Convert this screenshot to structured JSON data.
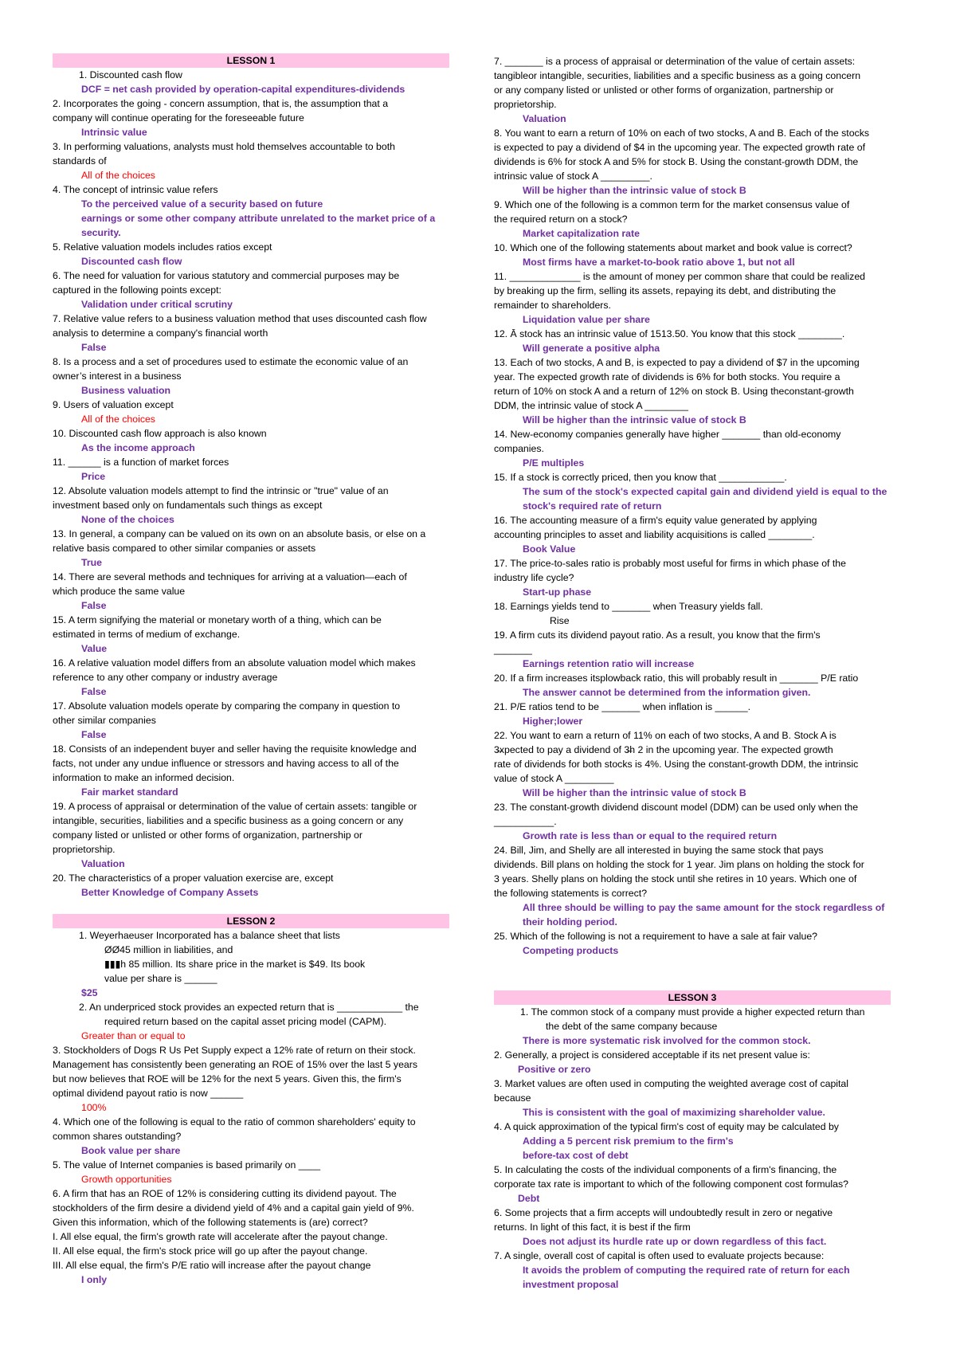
{
  "colors": {
    "answer": "#7030a0",
    "alt_answer": "#ff0000",
    "header_band": "#ffc3e6",
    "text": "#000000"
  },
  "left_column": [
    {
      "k": "h",
      "t": "LESSON 1"
    },
    {
      "k": "n1",
      "t": "1.  Discounted cash flow"
    },
    {
      "k": "a",
      "t": "DCF = net cash provided by operation-capital expenditures-dividends"
    },
    {
      "k": "q",
      "t": "2. Incorporates the going - concern assumption, that is, the assumption that a"
    },
    {
      "k": "q",
      "t": "company will continue operating for the foreseeable future"
    },
    {
      "k": "a",
      "t": "Intrinsic value"
    },
    {
      "k": "q",
      "t": "3. In performing valuations, analysts must hold themselves accountable to both"
    },
    {
      "k": "q",
      "t": "standards of"
    },
    {
      "k": "r",
      "t": "All of the choices"
    },
    {
      "k": "q",
      "t": "4. The concept of intrinsic value refers"
    },
    {
      "k": "a",
      "t": "To the perceived value of a security based on future"
    },
    {
      "k": "a",
      "t": "earnings or some other company attribute unrelated to the market price of a"
    },
    {
      "k": "a",
      "t": "security."
    },
    {
      "k": "q",
      "t": "5. Relative valuation models includes ratios except"
    },
    {
      "k": "a",
      "t": "Discounted cash flow"
    },
    {
      "k": "q",
      "t": "6. The need for valuation for various statutory and commercial purposes may be"
    },
    {
      "k": "q",
      "t": "captured in the following points except:"
    },
    {
      "k": "a",
      "t": "Validation under critical scrutiny"
    },
    {
      "k": "q",
      "t": "7. Relative value refers to a business valuation method that uses discounted cash flow"
    },
    {
      "k": "q",
      "t": "analysis to determine a company's financial worth"
    },
    {
      "k": "a",
      "t": "False"
    },
    {
      "k": "q",
      "t": "8. Is a process and a set of procedures used to estimate the economic value of an"
    },
    {
      "k": "q",
      "t": "owner’s interest in a business"
    },
    {
      "k": "a",
      "t": "Business valuation"
    },
    {
      "k": "q",
      "t": "9. Users of valuation except"
    },
    {
      "k": "r",
      "t": "All of the choices"
    },
    {
      "k": "q",
      "t": "10. Discounted cash flow approach is also known"
    },
    {
      "k": "a",
      "t": "As the income approach"
    },
    {
      "k": "q",
      "t": "11. ______ is a function of market forces"
    },
    {
      "k": "a",
      "t": "Price"
    },
    {
      "k": "q",
      "t": "12. Absolute valuation models attempt to find the intrinsic or \"true\" value of an"
    },
    {
      "k": "q",
      "t": "investment based only on fundamentals such things as except"
    },
    {
      "k": "a",
      "t": "None of the choices"
    },
    {
      "k": "q",
      "t": "13. In general, a company can be valued on its own on an absolute basis, or else on a"
    },
    {
      "k": "q",
      "t": "relative basis compared to other similar companies or assets"
    },
    {
      "k": "a",
      "t": "True"
    },
    {
      "k": "q",
      "t": "14. There are several methods and techniques for arriving at a valuation—each of"
    },
    {
      "k": "q",
      "t": "which produce the same value"
    },
    {
      "k": "a",
      "t": "False"
    },
    {
      "k": "q",
      "t": "15. A term signifying the material or monetary worth of a thing, which can be"
    },
    {
      "k": "q",
      "t": "estimated in terms of medium of exchange."
    },
    {
      "k": "a",
      "t": "Value"
    },
    {
      "k": "q",
      "t": "16. A relative valuation model differs from an absolute valuation model which makes"
    },
    {
      "k": "q",
      "t": "reference to any other company or industry average"
    },
    {
      "k": "a",
      "t": "False"
    },
    {
      "k": "q",
      "t": "17. Absolute valuation models operate by comparing the company in question to"
    },
    {
      "k": "q",
      "t": "other similar companies"
    },
    {
      "k": "a",
      "t": "False"
    },
    {
      "k": "q",
      "t": "18. Consists of an independent buyer and seller having the requisite knowledge and"
    },
    {
      "k": "q",
      "t": "facts, not under any undue influence or stressors and having access to all of the"
    },
    {
      "k": "q",
      "t": "information to make an informed decision."
    },
    {
      "k": "a",
      "t": "Fair market standard"
    },
    {
      "k": "q",
      "t": "19. A process of appraisal or determination of the value of certain assets: tangible or"
    },
    {
      "k": "q",
      "t": "intangible, securities, liabilities and a specific business as a going concern or any"
    },
    {
      "k": "q",
      "t": "company listed or unlisted or other forms of organization, partnership or"
    },
    {
      "k": "q",
      "t": "proprietorship."
    },
    {
      "k": "a",
      "t": "Valuation"
    },
    {
      "k": "q",
      "t": "20. The characteristics of a proper valuation exercise are, except"
    },
    {
      "k": "a",
      "t": "Better Knowledge of Company Assets"
    },
    {
      "k": "blank",
      "t": ""
    },
    {
      "k": "h",
      "t": "LESSON 2"
    },
    {
      "k": "n1",
      "t": "1. Weyerhaeuser Incorporated has a balance sheet that lists"
    },
    {
      "k": "n2",
      "t": "ØØ45 million in liabilities, and"
    },
    {
      "k": "n2",
      "t": "▮▮▮h                 85 million. Its share price in the market is $49. Its  book"
    },
    {
      "k": "n2",
      "t": "value per share is ______"
    },
    {
      "k": "a0",
      "t": "$25"
    },
    {
      "k": "n1",
      "t": "2. An underpriced stock provides an expected return that is ____________ the"
    },
    {
      "k": "n2",
      "t": "required return based on the capital asset pricing model (CAPM)."
    },
    {
      "k": "r",
      "t": "Greater than or equal to"
    },
    {
      "k": "q",
      "t": "3. Stockholders of Dogs R Us Pet Supply expect a 12% rate of return on their stock."
    },
    {
      "k": "q",
      "t": "Management has consistently been generating an ROE of 15% over the last 5 years"
    },
    {
      "k": "q",
      "t": "but now believes that ROE will be 12% for the next 5 years. Given this, the firm's"
    },
    {
      "k": "q",
      "t": "optimal dividend payout ratio is now ______"
    },
    {
      "k": "r",
      "t": "100%"
    },
    {
      "k": "q",
      "t": "4. Which one of the following is equal to the ratio of common shareholders' equity to"
    },
    {
      "k": "q",
      "t": "common shares outstanding?"
    },
    {
      "k": "a",
      "t": "Book value per share"
    },
    {
      "k": "q",
      "t": "5. The value of Internet companies is based primarily on ____"
    },
    {
      "k": "r",
      "t": "Growth opportunities"
    },
    {
      "k": "q",
      "t": "6. A firm that has an ROE of 12% is considering cutting its dividend payout. The"
    },
    {
      "k": "q",
      "t": "stockholders of the firm desire a dividend yield of 4% and a capital gain yield of 9%."
    },
    {
      "k": "q",
      "t": "Given this information, which of the following statements is (are) correct?"
    },
    {
      "k": "q",
      "t": "I. All else equal, the firm's growth rate will accelerate after the payout change."
    },
    {
      "k": "q",
      "t": "II. All else equal, the firm's stock price will go up after the payout change."
    },
    {
      "k": "q",
      "t": "III. All else equal, the firm's P/E ratio will increase after the payout change"
    },
    {
      "k": "a",
      "t": "I only"
    }
  ],
  "right_column": [
    {
      "k": "q",
      "t": "7. _______ is a process of appraisal or determination of the value of certain assets:"
    },
    {
      "k": "q",
      "t": "tangibleor intangible, securities, liabilities and a specific business as a going concern"
    },
    {
      "k": "q",
      "t": "or any company listed or unlisted or other forms of organization, partnership or"
    },
    {
      "k": "q",
      "t": "proprietorship."
    },
    {
      "k": "a",
      "t": "Valuation"
    },
    {
      "k": "q",
      "t": "8. You want to earn a return of 10% on each of two stocks, A and B. Each of the stocks"
    },
    {
      "k": "q",
      "t": "is expected to pay a dividend of $4 in the upcoming year. The expected growth rate of"
    },
    {
      "k": "q",
      "t": "dividends is 6% for stock A and 5% for stock B. Using the constant-growth DDM, the"
    },
    {
      "k": "q",
      "t": "intrinsic value of stock A _________."
    },
    {
      "k": "a",
      "t": "Will be higher than the intrinsic value of stock B"
    },
    {
      "k": "q",
      "t": "9. Which one of the following is a common term for the market consensus value of"
    },
    {
      "k": "q",
      "t": "the required return on a stock?"
    },
    {
      "k": "a",
      "t": "Market capitalization rate"
    },
    {
      "k": "q",
      "t": "10. Which one of the following statements about market and book value is correct?"
    },
    {
      "k": "a",
      "t": "Most firms have a market-to-book ratio above 1, but not all"
    },
    {
      "k": "q",
      "t": "11. _____________ is the amount of money per common share that could be realized"
    },
    {
      "k": "q",
      "t": "by breaking up the firm, selling its assets, repaying its debt, and distributing the"
    },
    {
      "k": "q",
      "t": "remainder to shareholders."
    },
    {
      "k": "a",
      "t": "Liquidation value per share"
    },
    {
      "k": "q",
      "t": "12. Ā stock has an intrinsic value of  1513.50. You know that this stock ________."
    },
    {
      "k": "a",
      "t": "Will generate a positive alpha"
    },
    {
      "k": "q",
      "t": "13. Each of two stocks, A and B, is expected to pay a dividend of $7 in the upcoming"
    },
    {
      "k": "q",
      "t": "year. The expected growth rate of dividends is 6% for both stocks. You require a"
    },
    {
      "k": "q",
      "t": "return of 10% on stock A and a return of 12% on stock B. Using theconstant-growth"
    },
    {
      "k": "q",
      "t": "DDM, the intrinsic value of stock A ________"
    },
    {
      "k": "a",
      "t": "Will be higher than the intrinsic value of stock B"
    },
    {
      "k": "q",
      "t": "14.  New-economy companies generally have higher _______ than old-economy"
    },
    {
      "k": "q",
      "t": "companies."
    },
    {
      "k": "a",
      "t": "P/E multiples"
    },
    {
      "k": "q",
      "t": "15.  If a stock is correctly priced, then you know that ____________."
    },
    {
      "k": "a",
      "t": "The sum of the stock's expected capital gain and dividend yield is equal to the"
    },
    {
      "k": "a",
      "t": "stock's required rate of return"
    },
    {
      "k": "q",
      "t": "16. The accounting measure of a firm's equity value generated by applying"
    },
    {
      "k": "q",
      "t": "accounting principles to asset and liability acquisitions is called ________."
    },
    {
      "k": "a",
      "t": " Book Value"
    },
    {
      "k": "q",
      "t": "17. The price-to-sales ratio is probably most useful for firms in which phase of the"
    },
    {
      "k": "q",
      "t": "industry life cycle?"
    },
    {
      "k": "a",
      "t": "Start-up phase"
    },
    {
      "k": "q",
      "t": "18. Earnings yields tend to _______ when Treasury yields fall."
    },
    {
      "k": "rise",
      "t": "Rise"
    },
    {
      "k": "q",
      "t": "19. A firm cuts its dividend payout ratio. As a result, you know that the firm's"
    },
    {
      "k": "q",
      "t": "_______"
    },
    {
      "k": "a",
      "t": "Earnings retention ratio will increase"
    },
    {
      "k": "q",
      "t": "20. If a firm increases itsplowback ratio, this will probably result in _______ P/E ratio"
    },
    {
      "k": "a",
      "t": "The answer cannot be determined from the information given."
    },
    {
      "k": "q",
      "t": "21. P/E ratios tend to be _______ when inflation is ______."
    },
    {
      "k": "a",
      "t": "Higher;lower"
    },
    {
      "k": "q",
      "t": "22. You want to earn a return of 11% on each of two stocks, A and B. Stock A is"
    },
    {
      "k": "q",
      "t": "3̶xpected to pay a dividend of  3̶h     2 in the upcoming year. The expected growth"
    },
    {
      "k": "q",
      "t": "rate of dividends for both stocks is 4%. Using the constant-growth DDM, the intrinsic"
    },
    {
      "k": "q",
      "t": "value of stock A _________"
    },
    {
      "k": "a",
      "t": "Will be higher than the intrinsic value of stock B"
    },
    {
      "k": "q",
      "t": "23. The constant-growth dividend discount model (DDM) can be used only when the"
    },
    {
      "k": "q",
      "t": "___________."
    },
    {
      "k": "a",
      "t": "Growth rate is less than or equal to the required return"
    },
    {
      "k": "q",
      "t": "24. Bill, Jim, and Shelly are all interested in buying the same stock that pays"
    },
    {
      "k": "q",
      "t": "dividends. Bill plans on holding the stock for 1 year. Jim plans on holding the stock for"
    },
    {
      "k": "q",
      "t": "3 years. Shelly plans on holding the stock until she retires in 10 years. Which one of"
    },
    {
      "k": "q",
      "t": "the following statements is correct?"
    },
    {
      "k": "a",
      "t": "All three should be willing to pay the same amount for the stock regardless of"
    },
    {
      "k": "a",
      "t": "their holding period."
    },
    {
      "k": "q",
      "t": "25. Which of the following is not a requirement to have a sale at fair value?"
    },
    {
      "k": "a",
      "t": "Competing products"
    },
    {
      "k": "gap",
      "t": ""
    },
    {
      "k": "blank",
      "t": ""
    },
    {
      "k": "h",
      "t": "LESSON 3"
    },
    {
      "k": "n1",
      "t": "1. The common stock of a company must provide a higher expected return than"
    },
    {
      "k": "n2",
      "t": "the debt of the same company because"
    },
    {
      "k": "a",
      "t": "There is more systematic risk involved for the common stock."
    },
    {
      "k": "q",
      "t": "2. Generally, a project is considered acceptable if its net present value is:"
    },
    {
      "k": "ab",
      "t": "Positive or zero"
    },
    {
      "k": "q",
      "t": "3. Market values are often used in computing the weighted average cost of capital"
    },
    {
      "k": "q",
      "t": "because"
    },
    {
      "k": "a",
      "t": "This is consistent with the goal of maximizing shareholder value."
    },
    {
      "k": "q",
      "t": "4. A quick approximation of the typical firm's cost of equity may be calculated by"
    },
    {
      "k": "a",
      "t": "Adding a 5 percent risk premium to the firm's"
    },
    {
      "k": "a",
      "t": "before-tax cost of debt"
    },
    {
      "k": "q",
      "t": "5. In calculating the costs of the individual components of a firm's financing, the"
    },
    {
      "k": "q",
      "t": "corporate tax rate is important to which of the following component cost formulas?"
    },
    {
      "k": "ab",
      "t": "Debt"
    },
    {
      "k": "q",
      "t": "6. Some projects that a firm accepts will undoubtedly result in zero or negative"
    },
    {
      "k": "q",
      "t": "returns. In light of this fact, it is best if the firm"
    },
    {
      "k": "a",
      "t": "Does not adjust its hurdle rate up or down regardless of this fact."
    },
    {
      "k": "q",
      "t": "7. A single, overall cost of capital is often used to evaluate projects because:"
    },
    {
      "k": "a",
      "t": "It avoids the problem of computing the required rate of return for each"
    },
    {
      "k": "a",
      "t": "investment proposal"
    }
  ]
}
